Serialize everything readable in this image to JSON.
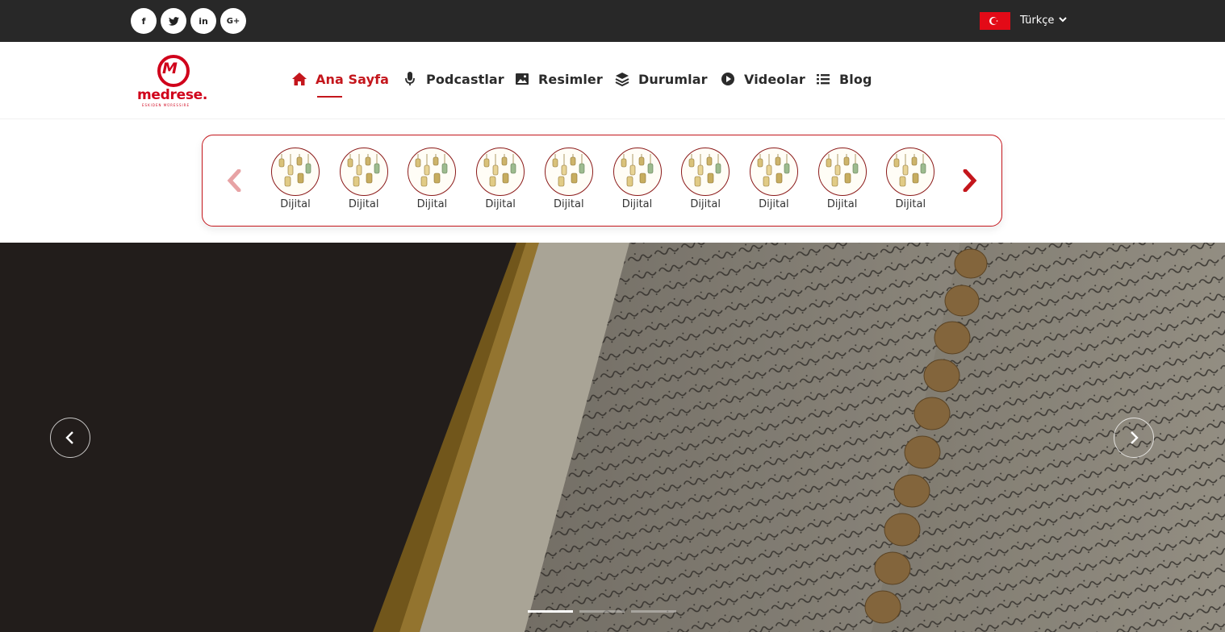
{
  "topbar": {
    "social": [
      {
        "name": "facebook",
        "glyph": "f"
      },
      {
        "name": "twitter",
        "glyph": "t"
      },
      {
        "name": "linkedin",
        "glyph": "in"
      },
      {
        "name": "google-plus",
        "glyph": "G+"
      }
    ],
    "language": {
      "label": "Türkçe",
      "flag": "turkey-flag-icon"
    }
  },
  "logo": {
    "mark": "M",
    "word": "medrese.",
    "tagline": "ESKIDEN MÜRESSIRE"
  },
  "nav": [
    {
      "label": "Ana Sayfa",
      "icon": "home-icon",
      "active": true
    },
    {
      "label": "Podcastlar",
      "icon": "microphone-icon",
      "active": false
    },
    {
      "label": "Resimler",
      "icon": "image-icon",
      "active": false
    },
    {
      "label": "Durumlar",
      "icon": "layers-icon",
      "active": false
    },
    {
      "label": "Videolar",
      "icon": "play-circle-icon",
      "active": false
    },
    {
      "label": "Blog",
      "icon": "list-icon",
      "active": false
    }
  ],
  "stories": {
    "items": [
      "Dijital",
      "Dijital",
      "Dijital",
      "Dijital",
      "Dijital",
      "Dijital",
      "Dijital",
      "Dijital",
      "Dijital",
      "Dijital"
    ]
  },
  "hero": {
    "slides": 3,
    "active_slide": 1
  },
  "colors": {
    "accent": "#c4161c",
    "topbar": "#282828",
    "hero_bg": "#2a2421"
  }
}
